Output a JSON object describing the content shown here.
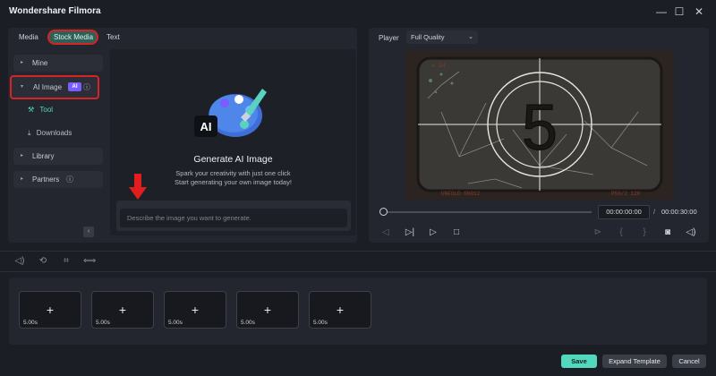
{
  "window": {
    "title": "Wondershare Filmora",
    "controls": [
      "—",
      "☐",
      "✕"
    ]
  },
  "media_tabs": [
    {
      "label": "Media"
    },
    {
      "label": "Stock Media"
    },
    {
      "label": "Text"
    }
  ],
  "sidebar": {
    "items": [
      {
        "label": "Mine"
      },
      {
        "label": "AI Image",
        "badge": "AI"
      },
      {
        "label": "Tool"
      },
      {
        "label": "Downloads"
      },
      {
        "label": "Library"
      },
      {
        "label": "Partners"
      }
    ],
    "collapse_glyph": "‹"
  },
  "generator": {
    "title": "Generate AI Image",
    "subtitle_line1": "Spark your creativity with just one click",
    "subtitle_line2": "Start generating your own image today!",
    "prompt_placeholder": "Describe the image you want to generate.",
    "logo_text": "AI"
  },
  "player": {
    "label": "Player",
    "quality": "Full Quality",
    "countdown_number": "5",
    "film_text_left": "UNFOLD 00012",
    "film_text_right": "P50/2 120",
    "film_text_top": "▸ 24",
    "current_time": "00:00:00:00",
    "separator": "/",
    "total_time": "00:00:30:00",
    "progress": 0
  },
  "timeline": {
    "slots": [
      {
        "duration": "5.00s"
      },
      {
        "duration": "5.00s"
      },
      {
        "duration": "5.00s"
      },
      {
        "duration": "5.00s"
      },
      {
        "duration": "5.00s"
      }
    ],
    "add_glyph": "+"
  },
  "footer": {
    "save_label": "Save",
    "expand_label": "Expand Template",
    "cancel_label": "Cancel"
  },
  "colors": {
    "accent": "#52d8bd",
    "highlight": "#d62424",
    "ai_badge": "#7b5cff"
  }
}
